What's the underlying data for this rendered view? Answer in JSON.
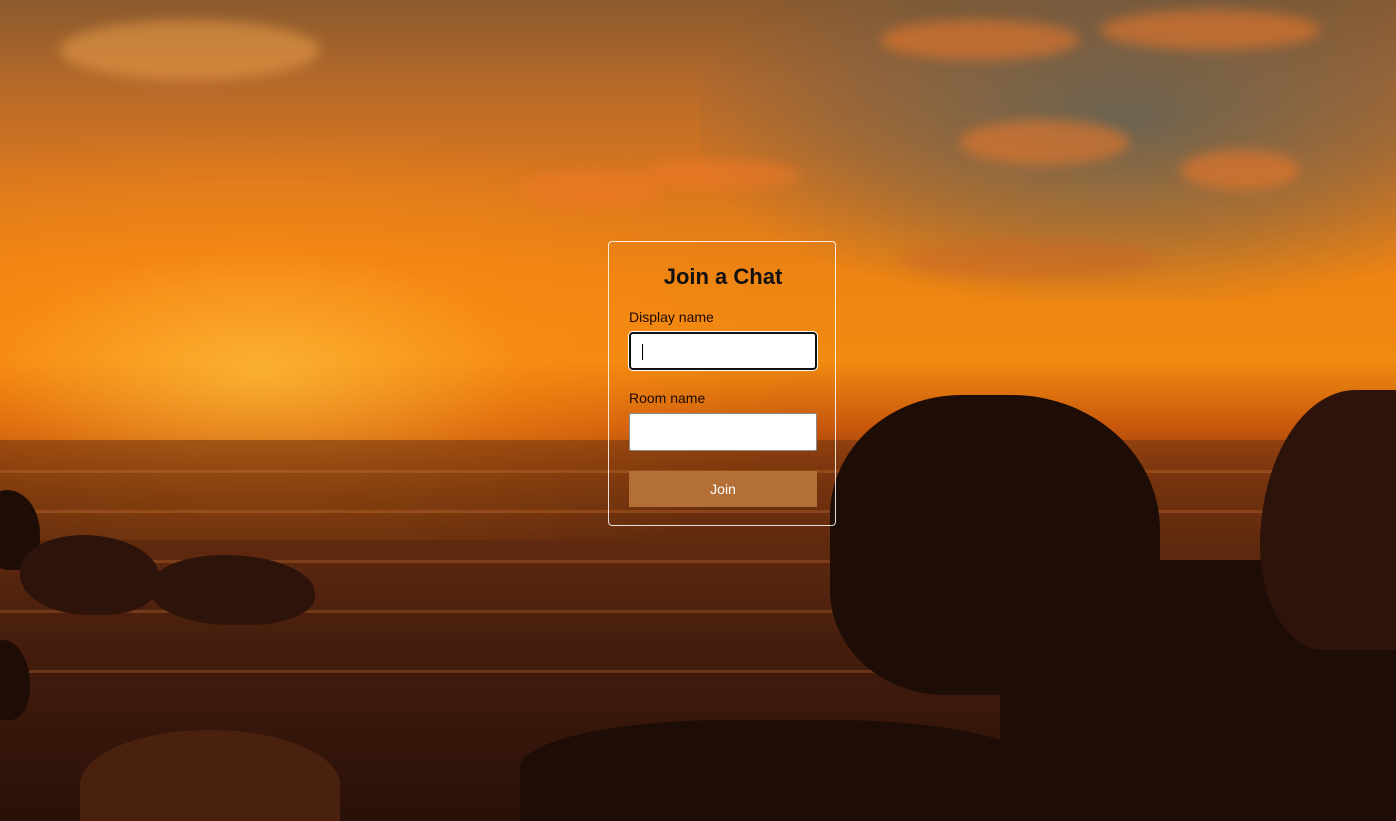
{
  "form": {
    "title": "Join a Chat",
    "display_name_label": "Display name",
    "display_name_value": "",
    "room_name_label": "Room name",
    "room_name_value": "",
    "join_label": "Join"
  },
  "colors": {
    "button_background": "#b36f36",
    "button_text": "#ffffff",
    "card_border": "#ffffff",
    "title_text": "#111111"
  },
  "background": {
    "scene": "sunset-over-sea-with-rocks"
  }
}
